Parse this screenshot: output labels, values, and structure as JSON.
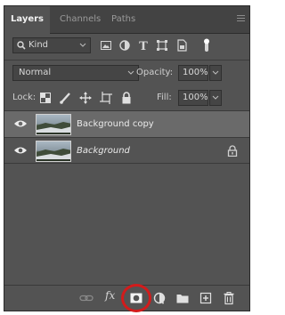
{
  "panel": {
    "tabs": [
      {
        "label": "Layers",
        "active": true
      },
      {
        "label": "Channels",
        "active": false
      },
      {
        "label": "Paths",
        "active": false
      }
    ],
    "menu_icon": "hamburger-menu-icon"
  },
  "filter": {
    "kind_label": "Kind",
    "icons": [
      "image-filter-icon",
      "adjustment-filter-icon",
      "type-filter-icon",
      "shape-filter-icon",
      "smart-object-filter-icon",
      "filter-toggle-icon"
    ]
  },
  "blend": {
    "mode": "Normal",
    "opacity_label": "Opacity:",
    "opacity_value": "100%"
  },
  "lock": {
    "label": "Lock:",
    "icons": [
      "lock-transparent-pixels-icon",
      "lock-image-pixels-icon",
      "lock-position-icon",
      "lock-artboard-icon",
      "lock-all-icon"
    ],
    "fill_label": "Fill:",
    "fill_value": "100%"
  },
  "layers": [
    {
      "name": "Background copy",
      "selected": true,
      "italic": false,
      "locked": false
    },
    {
      "name": "Background",
      "selected": false,
      "italic": true,
      "locked": true
    }
  ],
  "bottom_icons": [
    "link-layers-icon",
    "fx-icon",
    "add-layer-mask-icon",
    "adjustment-layer-icon",
    "new-group-icon",
    "new-layer-icon",
    "delete-layer-icon"
  ],
  "fx_label": "fx",
  "colors": {
    "panel_bg": "#535353",
    "selected_row": "#6a6a6a",
    "highlight_ring": "#d21b1b"
  }
}
